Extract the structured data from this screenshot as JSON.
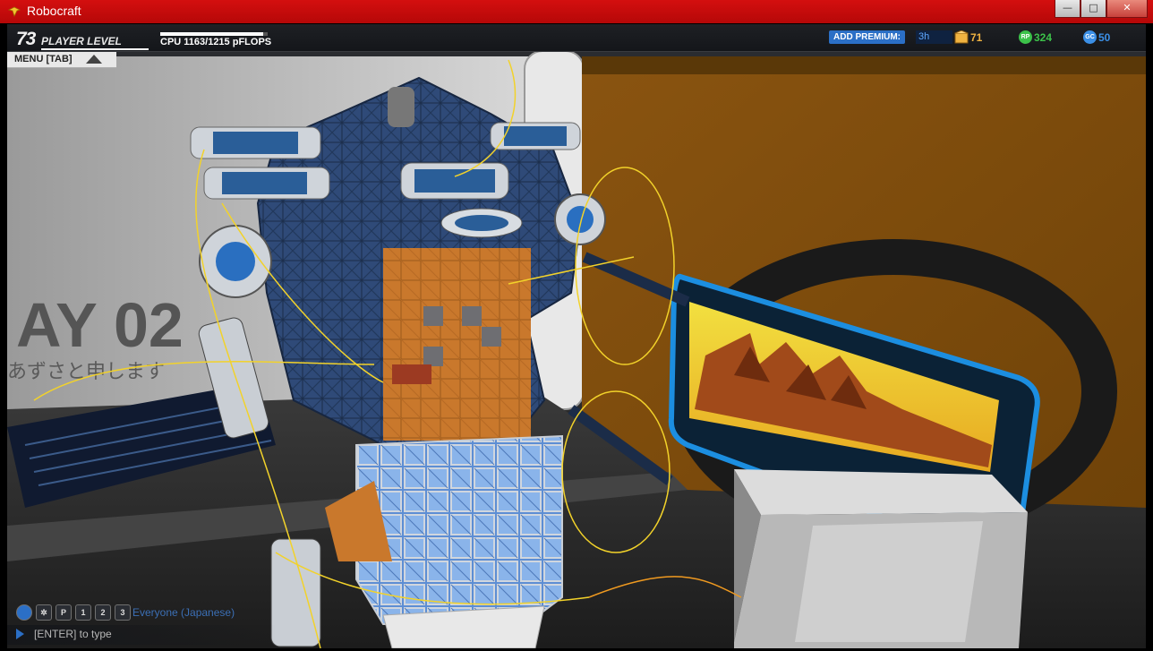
{
  "window": {
    "title": "Robocraft",
    "buttons": [
      "—",
      "□",
      "✕"
    ]
  },
  "hud": {
    "player_level": "73",
    "player_level_label": "PLAYER LEVEL",
    "cpu_label": "CPU 1163/1215 pFLOPS",
    "cpu_usage_fraction": 0.957,
    "premium_label": "ADD PREMIUM:",
    "premium_value": "3h",
    "currencies": [
      {
        "icon": "crate-icon",
        "value": "71",
        "color": "#f0b341"
      },
      {
        "icon": "rp-icon",
        "icon_text": "RP",
        "value": "324",
        "color": "#3cc24a"
      },
      {
        "icon": "gc-icon",
        "icon_text": "GC",
        "value": "50",
        "color": "#3b8fe6"
      }
    ]
  },
  "menu": {
    "label": "MENU [TAB]"
  },
  "scene": {
    "wall_text": "AY 02",
    "wall_japanese": "あずさと申します"
  },
  "chat": {
    "icons": [
      "globe-icon",
      "accessibility-icon",
      "party-icon",
      "player-1-icon",
      "player-2-icon",
      "player-3-icon"
    ],
    "icon_labels": [
      "",
      "",
      "P",
      "1",
      "2",
      "3"
    ],
    "channel": "Everyone (Japanese)",
    "input_placeholder": "[ENTER] to type"
  }
}
